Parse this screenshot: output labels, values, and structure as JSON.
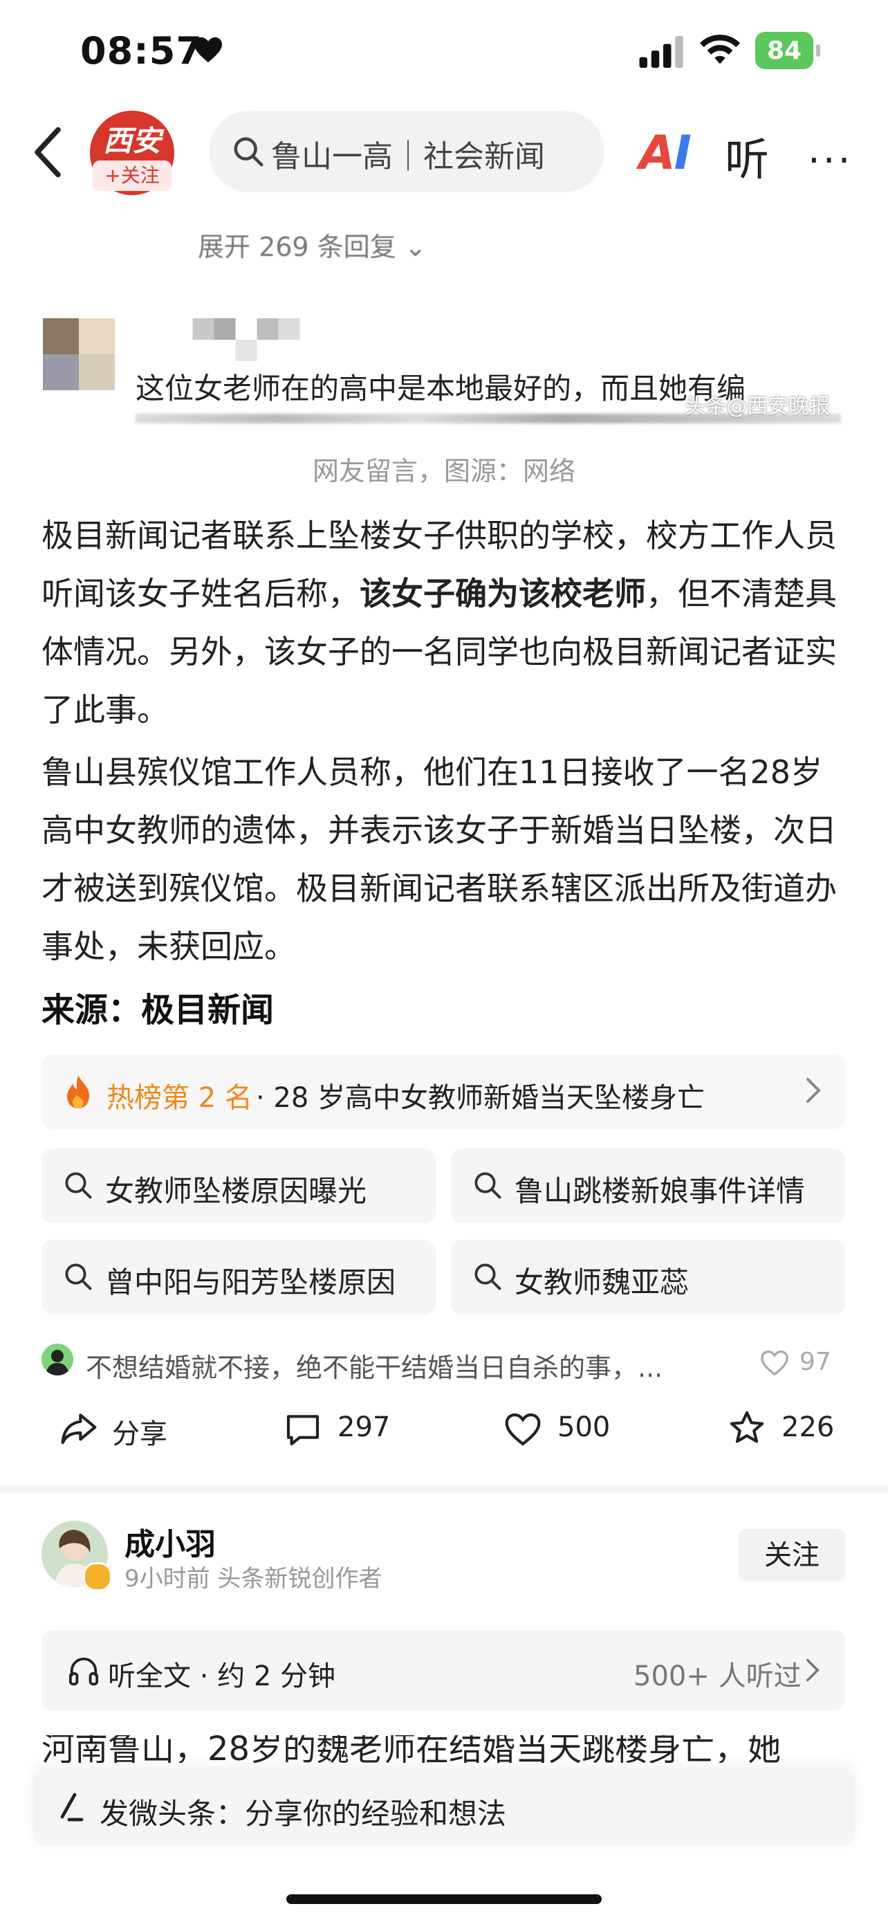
{
  "status_bar": {
    "time": "08:57",
    "battery": "84"
  },
  "nav": {
    "account_logo_text": "西安",
    "follow_badge": "+关注",
    "search_text": "鲁山一高｜社会新闻",
    "ai_label_a": "A",
    "ai_label_i": "I",
    "listen_label": "听",
    "more_label": "···"
  },
  "embedded_image": {
    "expand_replies": "展开 269 条回复",
    "comment_text": "这位女老师在的高中是本地最好的，而且她有编",
    "watermark": "头条@西安晚报",
    "caption": "网友留言，图源：网络"
  },
  "article": {
    "p1_part1": "极目新闻记者联系上坠楼女子供职的学校，校方工作人员听闻该女子姓名后称，",
    "p1_bold": "该女子确为该校老师",
    "p1_part2": "，但不清楚具体情况。另外，该女子的一名同学也向极目新闻记者证实了此事。",
    "p2": "鲁山县殡仪馆工作人员称，他们在11日接收了一名28岁高中女教师的遗体，并表示该女子于新婚当日坠楼，次日才被送到殡仪馆。极目新闻记者联系辖区派出所及街道办事处，未获回应。",
    "source": "来源：极目新闻"
  },
  "hot": {
    "rank": "热榜第 2 名",
    "title": "· 28 岁高中女教师新婚当天坠楼身亡"
  },
  "related_searches": [
    "女教师坠楼原因曝光",
    "鲁山跳楼新娘事件详情",
    "曾中阳与阳芳坠楼原因",
    "女教师魏亚蕊"
  ],
  "comment_preview": {
    "text": "不想结婚就不接，绝不能干结婚当日自杀的事，...",
    "likes": "97"
  },
  "actions": {
    "share": "分享",
    "comments": "297",
    "likes": "500",
    "favorites": "226"
  },
  "author": {
    "name": "成小羽",
    "time": "9小时前",
    "role": "头条新锐创作者",
    "follow": "关注"
  },
  "listen_bar": {
    "label": "听全文 · 约 2 分钟",
    "count": "500+ 人听过"
  },
  "next_text": "河南鲁山，28岁的魏老师在结婚当天跳楼身亡，她",
  "compose": {
    "placeholder": "发微头条：分享你的经验和想法"
  },
  "colors": {
    "accent_red": "#e0302a",
    "hot_orange": "#f0891a",
    "battery_green": "#5ac85a"
  }
}
